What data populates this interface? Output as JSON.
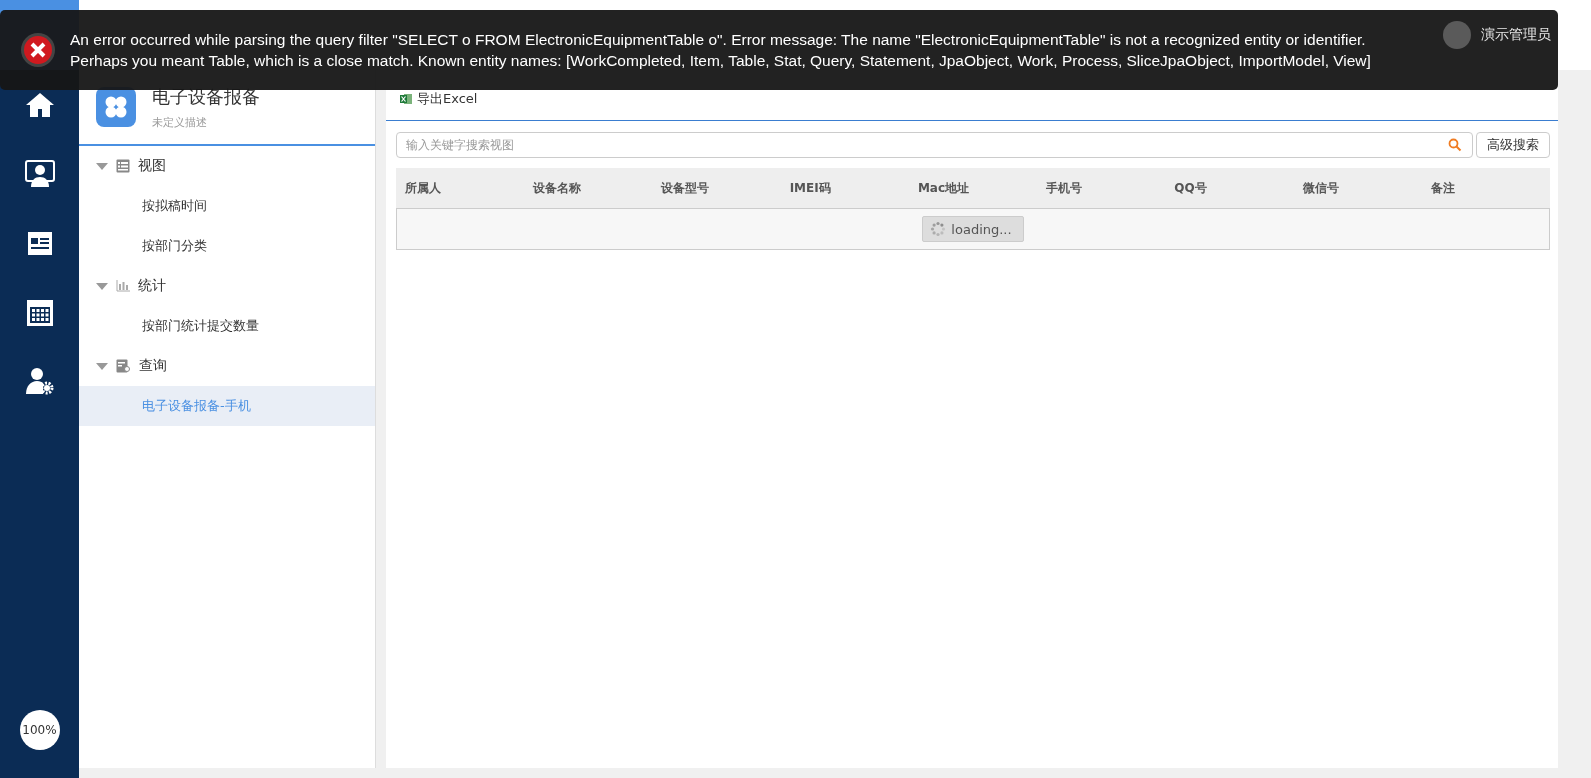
{
  "top_bar": {
    "user_name": "演示管理员"
  },
  "error_toast": {
    "lines": [
      "An error occurred while parsing the query filter \"SELECT o FROM ElectronicEquipmentTable o\". Error message: The name \"ElectronicEquipmentTable\" is not a recognized entity or identifier.",
      "Perhaps you meant Table, which is a close match. Known entity names: [WorkCompleted, Item, Table, Stat, Query, Statement, JpaObject, Work, Process, SliceJpaObject, ImportModel, View]"
    ]
  },
  "nav": {
    "items": [
      {
        "kind": "home"
      },
      {
        "kind": "person"
      },
      {
        "kind": "news"
      },
      {
        "kind": "calendar"
      },
      {
        "kind": "admin"
      }
    ],
    "zoom": "100%"
  },
  "app": {
    "title": "电子设备报备",
    "description": "未定义描述"
  },
  "tree": [
    {
      "label": "视图",
      "kind": "view",
      "expanded": true,
      "children": [
        {
          "label": "按拟稿时间",
          "selected": false
        },
        {
          "label": "按部门分类",
          "selected": false
        }
      ]
    },
    {
      "label": "统计",
      "kind": "stat",
      "expanded": true,
      "children": [
        {
          "label": "按部门统计提交数量",
          "selected": false
        }
      ]
    },
    {
      "label": "查询",
      "kind": "query",
      "expanded": true,
      "children": [
        {
          "label": "电子设备报备-手机",
          "selected": true
        }
      ]
    }
  ],
  "toolbar": {
    "export": "导出Excel"
  },
  "search": {
    "placeholder": "输入关键字搜索视图",
    "advanced": "高级搜索"
  },
  "table": {
    "columns": [
      "所属人",
      "设备名称",
      "设备型号",
      "IMEI码",
      "Mac地址",
      "手机号",
      "QQ号",
      "微信号",
      "备注"
    ],
    "loading": "loading..."
  }
}
